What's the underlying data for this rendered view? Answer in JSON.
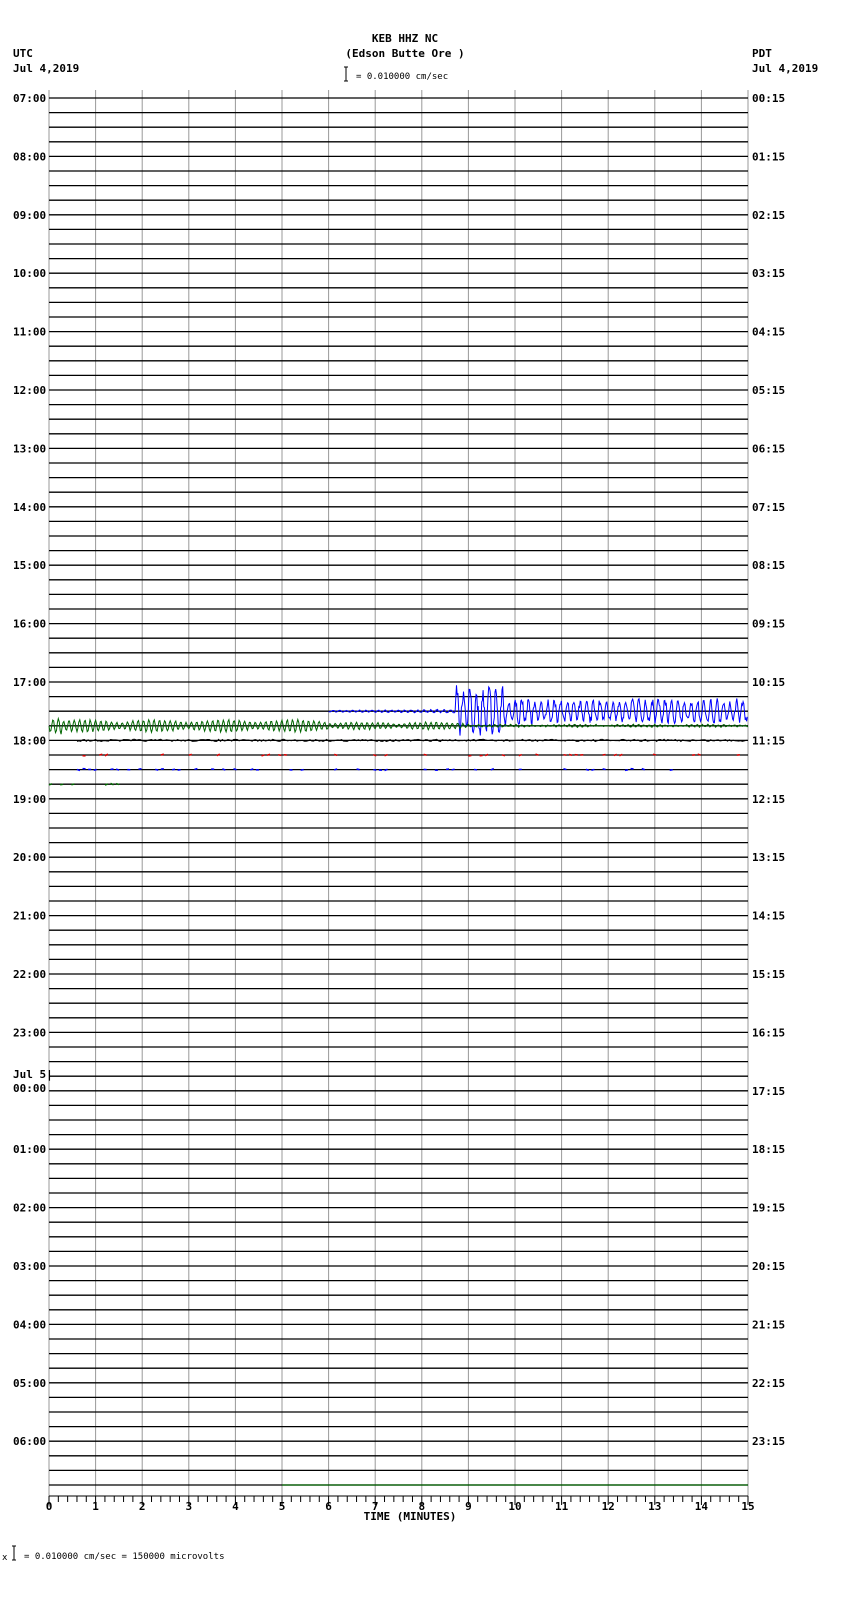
{
  "header": {
    "station": "KEB HHZ NC",
    "location": "(Edson Butte Ore )",
    "left_zone": "UTC",
    "left_date": "Jul 4,2019",
    "right_zone": "PDT",
    "right_date": "Jul 4,2019",
    "scale_text": "= 0.010000 cm/sec"
  },
  "footer": {
    "scale_text": "= 0.010000 cm/sec =  150000 microvolts",
    "scale_mark": "x"
  },
  "chart_data": {
    "type": "line",
    "title": "KEB HHZ NC (Edson Butte Ore )",
    "xlabel": "TIME (MINUTES)",
    "xlim": [
      0,
      15
    ],
    "x_ticks": [
      "0",
      "1",
      "2",
      "3",
      "4",
      "5",
      "6",
      "7",
      "8",
      "9",
      "10",
      "11",
      "12",
      "13",
      "14",
      "15"
    ],
    "rows_per_hour": 4,
    "minutes_per_row": 15,
    "left_labels": [
      "07:00",
      "08:00",
      "09:00",
      "10:00",
      "11:00",
      "12:00",
      "13:00",
      "14:00",
      "15:00",
      "16:00",
      "17:00",
      "18:00",
      "19:00",
      "20:00",
      "21:00",
      "22:00",
      "23:00",
      "Jul 5|00:00",
      "01:00",
      "02:00",
      "03:00",
      "04:00",
      "05:00",
      "06:00"
    ],
    "right_labels": [
      "00:15",
      "01:15",
      "02:15",
      "03:15",
      "04:15",
      "05:15",
      "06:15",
      "07:15",
      "08:15",
      "09:15",
      "10:15",
      "11:15",
      "12:15",
      "13:15",
      "14:15",
      "15:15",
      "16:15",
      "17:15",
      "18:15",
      "19:15",
      "20:15",
      "21:15",
      "22:15",
      "23:15"
    ],
    "trace_colors": [
      "#000000",
      "#dd0000",
      "#0000ff",
      "#006600"
    ],
    "traces": [
      {
        "row_start": "17:30",
        "kind": "earthquake",
        "start_min": 6.0,
        "onset_min": 8.7,
        "peak_amplitude_rows": 1.9,
        "coda_amplitude_rows": 0.9
      },
      {
        "row_start": "17:45",
        "kind": "oscillation",
        "start_min": 0,
        "end_min": 15,
        "amplitude_rows": 0.5
      },
      {
        "row_start": "18:00",
        "kind": "noise",
        "start_min": 0.6,
        "end_min": 15
      },
      {
        "row_start": "18:15",
        "kind": "sparse",
        "start_min": 0,
        "end_min": 15
      },
      {
        "row_start": "18:30",
        "kind": "sparse",
        "start_min": 0,
        "end_min": 13.5
      },
      {
        "row_start": "18:45",
        "kind": "sparse",
        "start_min": 0,
        "end_min": 1.7
      },
      {
        "row_start": "06:45",
        "kind": "flat",
        "start_min": 5,
        "end_min": 15
      }
    ]
  }
}
